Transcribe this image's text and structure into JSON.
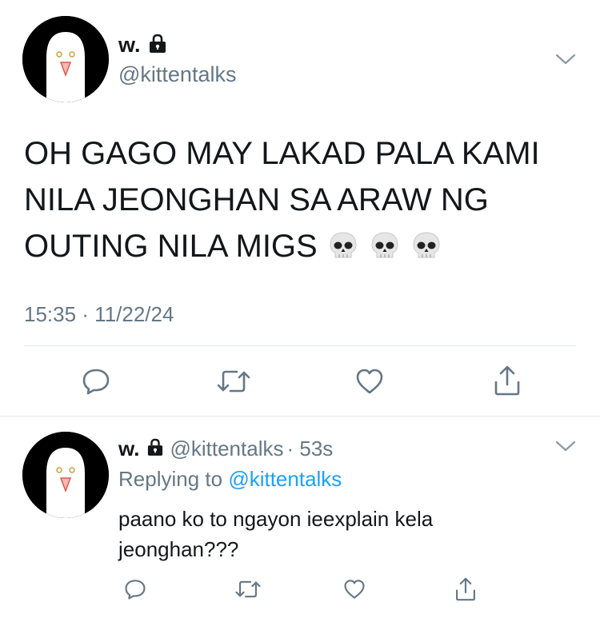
{
  "main_tweet": {
    "display_name": "w.",
    "handle": "@kittentalks",
    "text": "OH GAGO MAY LAKAD PALA KAMI NILA JEONGHAN SA ARAW NG OUTING NILA MIGS",
    "emoji": [
      "skull",
      "skull",
      "skull"
    ],
    "timestamp": "15:35 · 11/22/24",
    "actions": [
      "reply-icon",
      "retweet-icon",
      "like-icon",
      "share-icon"
    ]
  },
  "reply_tweet": {
    "display_name": "w.",
    "handle": "@kittentalks",
    "time": "· 53s",
    "replying_to_label": "Replying to",
    "replying_to_handle": "@kittentalks",
    "text": "paano ko to ngayon ieexplain kela jeonghan???",
    "actions": [
      "reply-icon",
      "retweet-icon",
      "like-icon",
      "share-icon"
    ]
  },
  "colors": {
    "text": "#14171a",
    "secondary": "#657786",
    "link": "#1da1f2",
    "divider": "#e1e8ed"
  }
}
